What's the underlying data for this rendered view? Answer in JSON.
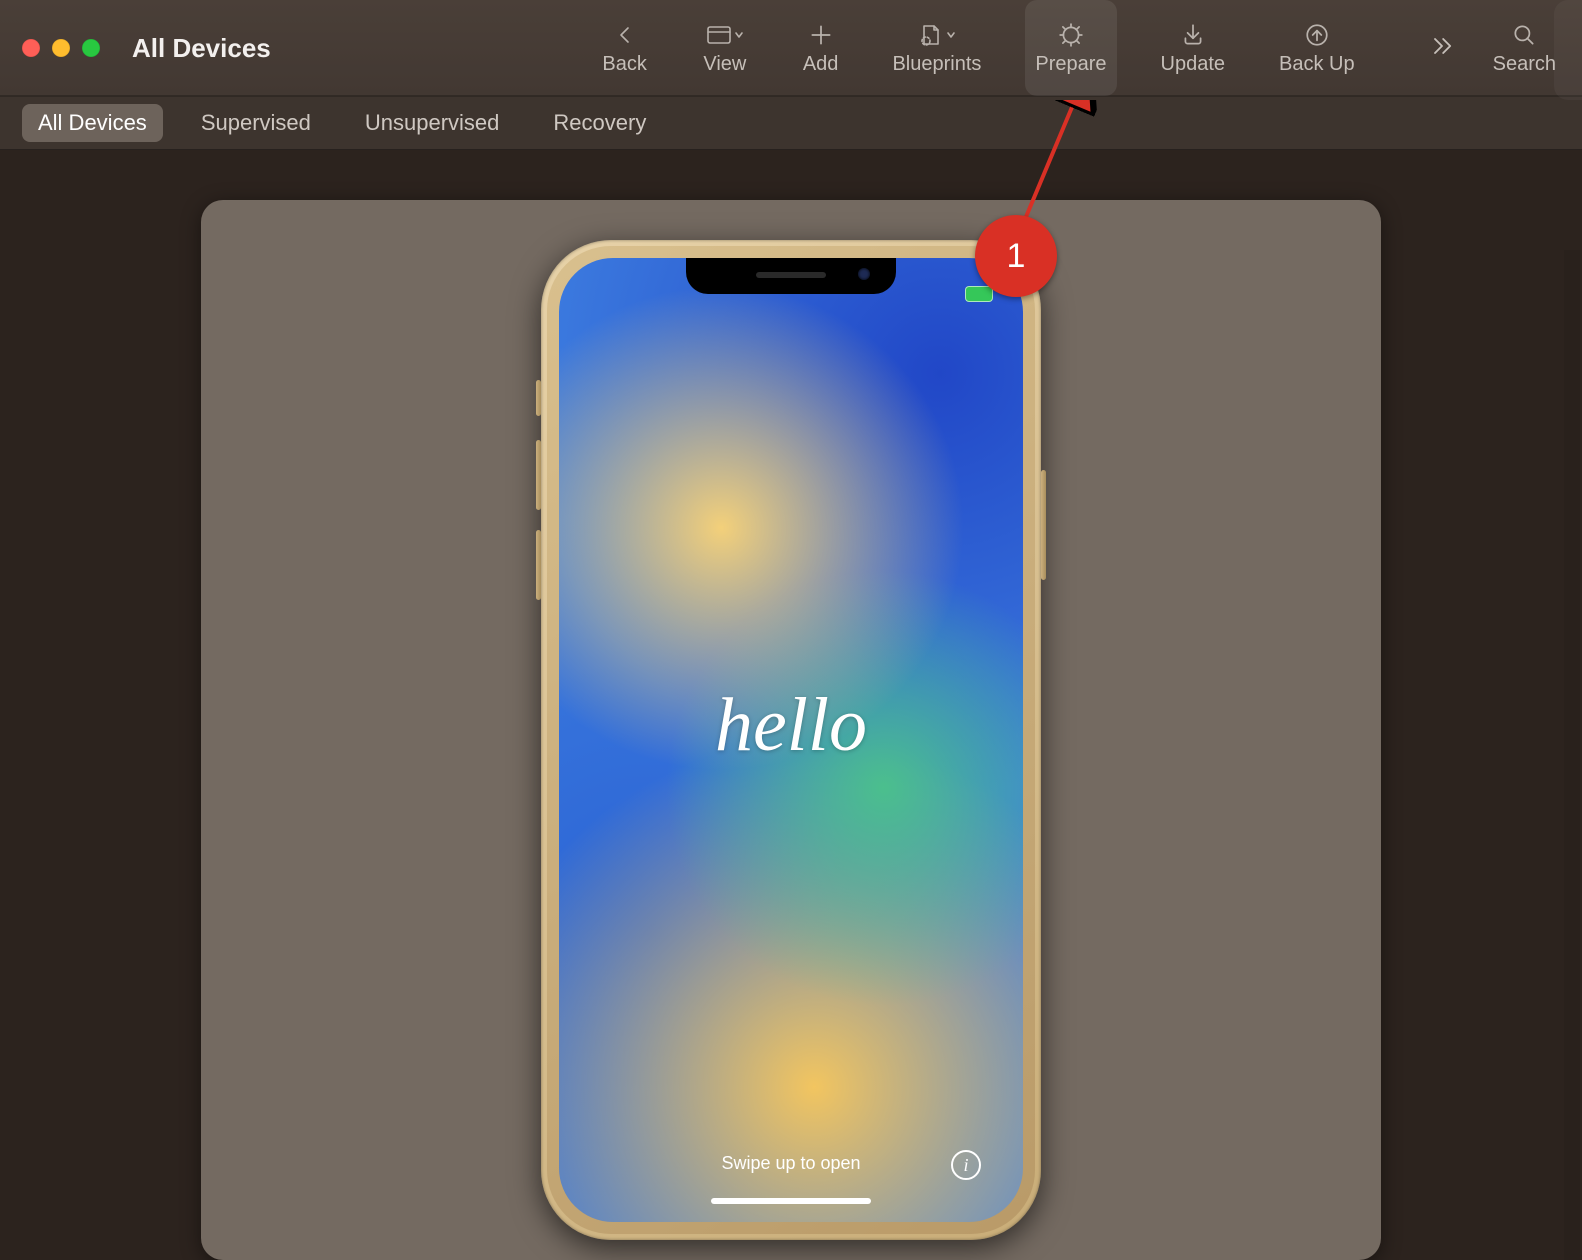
{
  "window": {
    "title": "All Devices"
  },
  "toolbar": {
    "items": [
      {
        "label": "Back",
        "icon": "chevron-left-icon"
      },
      {
        "label": "View",
        "icon": "window-dropdown-icon"
      },
      {
        "label": "Add",
        "icon": "plus-icon"
      },
      {
        "label": "Blueprints",
        "icon": "blueprint-dropdown-icon"
      },
      {
        "label": "Prepare",
        "icon": "gear-icon",
        "highlighted": true
      },
      {
        "label": "Update",
        "icon": "download-icon"
      },
      {
        "label": "Back Up",
        "icon": "upload-icon"
      }
    ],
    "overflow_icon": "chevrons-right-icon",
    "search_label": "Search",
    "search_icon": "search-icon"
  },
  "scopebar": {
    "items": [
      {
        "label": "All Devices",
        "active": true
      },
      {
        "label": "Supervised",
        "active": false
      },
      {
        "label": "Unsupervised",
        "active": false
      },
      {
        "label": "Recovery",
        "active": false
      }
    ]
  },
  "device_preview": {
    "greeting": "hello",
    "hint": "Swipe up to open",
    "info_glyph": "i"
  },
  "annotation": {
    "step_number": "1"
  }
}
